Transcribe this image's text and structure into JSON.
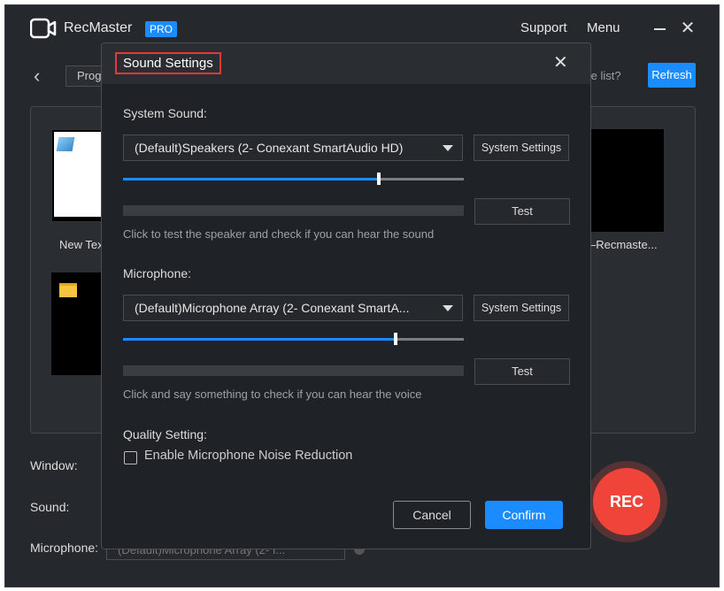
{
  "app": {
    "name": "RecMaster",
    "badge": "PRO",
    "support": "Support",
    "menu": "Menu"
  },
  "background": {
    "tab_label": "Prog",
    "list_question": "n the list?",
    "refresh": "Refresh",
    "thumb1_label": "New Tex",
    "thumb3_label": "–Recmaste...",
    "window_label": "Window:",
    "sound_label": "Sound:",
    "mic_label": "Microphone:",
    "mic_select_value": "(Default)Microphone Array (2- I...",
    "rec_label": "REC"
  },
  "dialog": {
    "title": "Sound Settings",
    "system_sound": {
      "label": "System Sound:",
      "device": "(Default)Speakers (2- Conexant SmartAudio HD)",
      "system_settings": "System Settings",
      "volume_fraction": 0.75,
      "test": "Test",
      "hint": "Click to test the speaker and check if you can hear the sound"
    },
    "microphone": {
      "label": "Microphone:",
      "device": "(Default)Microphone Array (2- Conexant SmartA...",
      "system_settings": "System Settings",
      "volume_fraction": 0.8,
      "test": "Test",
      "hint": "Click and say something to check if you can hear the voice"
    },
    "quality": {
      "label": "Quality Setting:",
      "noise_reduction_label": "Enable Microphone Noise Reduction",
      "noise_reduction_checked": false
    },
    "cancel": "Cancel",
    "confirm": "Confirm"
  },
  "colors": {
    "accent": "#1a8cff",
    "rec": "#f0443a",
    "highlight_border": "#e53935"
  }
}
